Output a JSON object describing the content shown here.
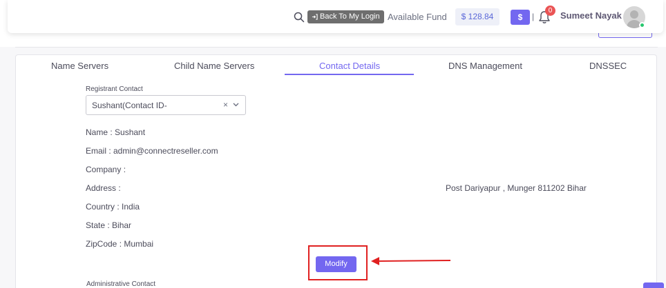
{
  "navbar": {
    "back_label": "Back To My Login",
    "fund_label": "Available Fund",
    "fund_value": "$ 128.84",
    "dollar_label": "$",
    "separator": "|",
    "notification_count": "0",
    "user_name": "Sumeet Nayak"
  },
  "tabs": [
    {
      "label": "Name Servers",
      "active": false
    },
    {
      "label": "Child Name Servers",
      "active": false
    },
    {
      "label": "Contact Details",
      "active": true
    },
    {
      "label": "DNS Management",
      "active": false
    },
    {
      "label": "DNSSEC",
      "active": false
    }
  ],
  "registrant": {
    "label": "Registrant Contact",
    "select_value": "Sushant(Contact ID-",
    "clear_glyph": "×"
  },
  "contact_info": {
    "name": "Name : Sushant",
    "email": "Email : admin@connectreseller.com",
    "company": "Company :",
    "address_label": "Address :",
    "address_value": "Post Dariyapur , Munger 811202 Bihar",
    "country": "Country : India",
    "state": "State : Bihar",
    "zipcode": "ZipCode : Mumbai"
  },
  "modify_label": "Modify",
  "admin_label": "Administrative Contact",
  "colors": {
    "accent": "#7367f0",
    "annotation": "#e02020",
    "badge": "#ea5455",
    "online": "#28c76f"
  },
  "icons": [
    "search-icon",
    "login-icon",
    "bell-icon",
    "chevron-down-icon",
    "avatar-icon"
  ]
}
